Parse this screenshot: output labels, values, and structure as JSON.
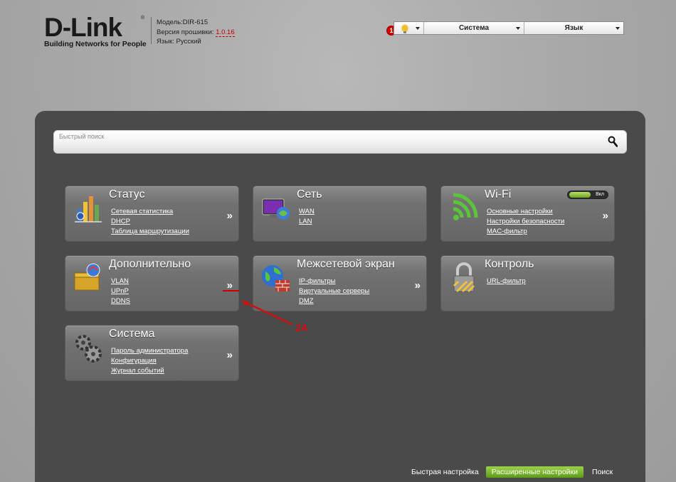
{
  "logo": {
    "brand": "D-Link",
    "reg": "®",
    "tagline": "Building Networks for People"
  },
  "device": {
    "model_label": "Модель:",
    "model": "DIR-615",
    "fw_label": "Версия прошивки:",
    "fw": "1.0.16",
    "lang_label": "Язык:",
    "lang": "Русский"
  },
  "topbar": {
    "notif_count": "1",
    "system": "Система",
    "language": "Язык"
  },
  "search": {
    "placeholder": "Быстрый поиск"
  },
  "tiles": [
    {
      "title": "Статус",
      "links": [
        "Сетевая статистика",
        "DHCP",
        "Таблица маршрутизации"
      ],
      "more": "»"
    },
    {
      "title": "Сеть",
      "links": [
        "WAN",
        "LAN"
      ],
      "more": ""
    },
    {
      "title": "Wi-Fi",
      "links": [
        "Основные настройки",
        "Настройки безопасности",
        "MAC-фильтр"
      ],
      "more": "»",
      "toggle": "Вкл"
    },
    {
      "title": "Дополнительно",
      "links": [
        "VLAN",
        "UPnP",
        "DDNS"
      ],
      "more": "»"
    },
    {
      "title": "Межсетевой экран",
      "links": [
        "IP-фильтры",
        "Виртуальные серверы",
        "DMZ"
      ],
      "more": "»"
    },
    {
      "title": "Контроль",
      "links": [
        "URL-фильтр"
      ],
      "more": ""
    },
    {
      "title": "Система",
      "links": [
        "Пароль администратора",
        "Конфигурация",
        "Журнал событий"
      ],
      "more": "»"
    }
  ],
  "annotation": {
    "number": "24",
    "color": "#cc1111"
  },
  "bottom_nav": {
    "quick": "Быстрая настройка",
    "advanced": "Расширенные настройки",
    "search": "Поиск"
  },
  "colors": {
    "panel": "#4a4a4a",
    "accent_green": "#7ab72f",
    "fw_red": "#c00000"
  }
}
